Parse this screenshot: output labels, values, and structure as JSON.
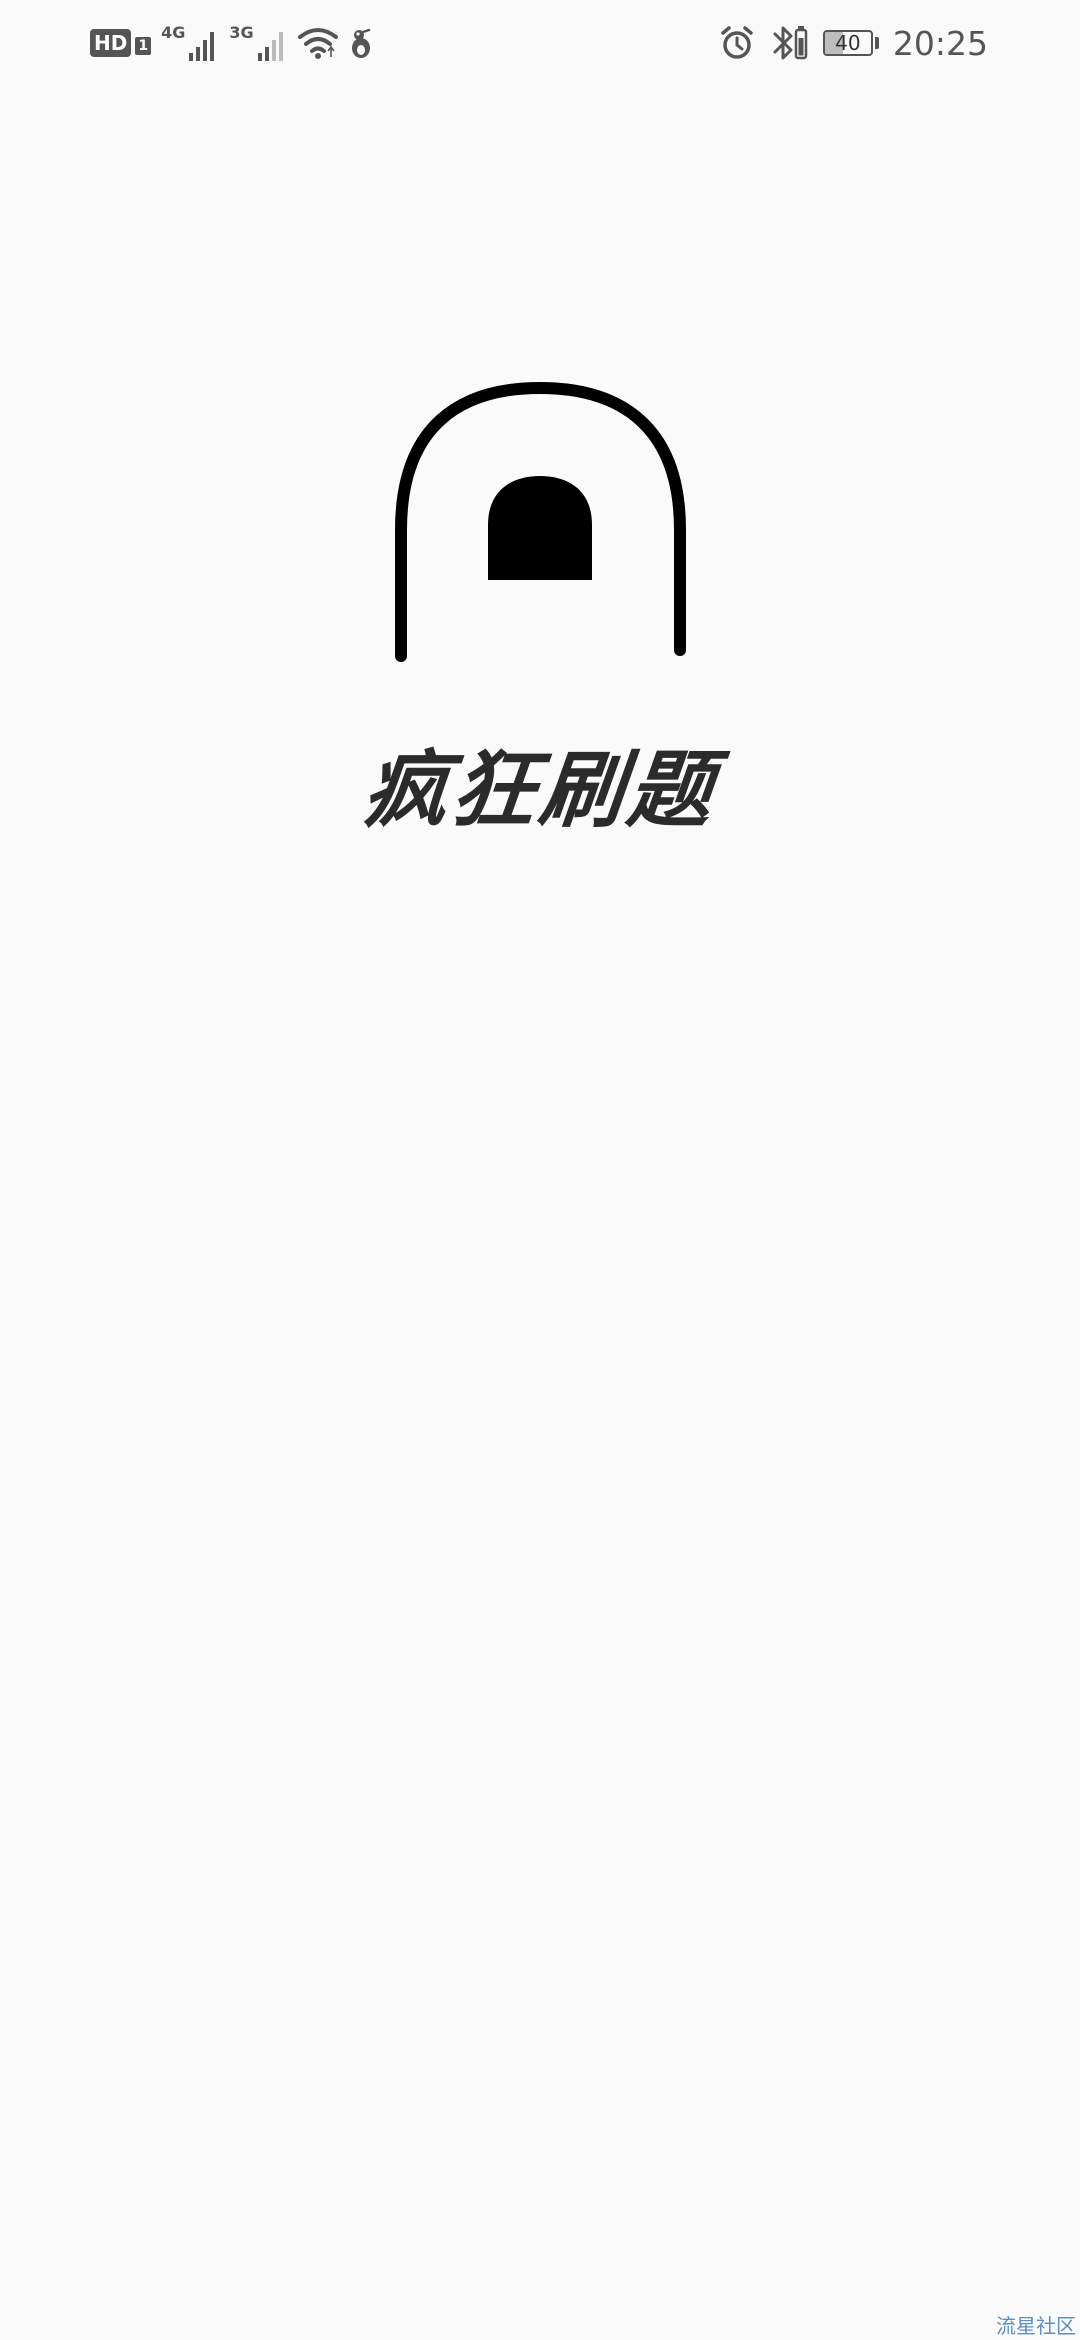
{
  "status_bar": {
    "hd_label": "HD",
    "sim_label": "1",
    "signal_1_label": "4G",
    "signal_2_label": "3G",
    "battery_level": "40",
    "time": "20:25",
    "icons": [
      "wifi-icon",
      "notification-app-icon",
      "alarm-icon",
      "bluetooth-icon",
      "battery-icon"
    ]
  },
  "splash": {
    "app_name": "疯狂刷题",
    "logo_icon": "arch-logo-icon"
  },
  "watermark": {
    "text": "流星社区"
  },
  "colors": {
    "background": "#fafafa",
    "logo": "#000000",
    "status_icons": "#555555",
    "watermark": "#5b8fc7"
  }
}
